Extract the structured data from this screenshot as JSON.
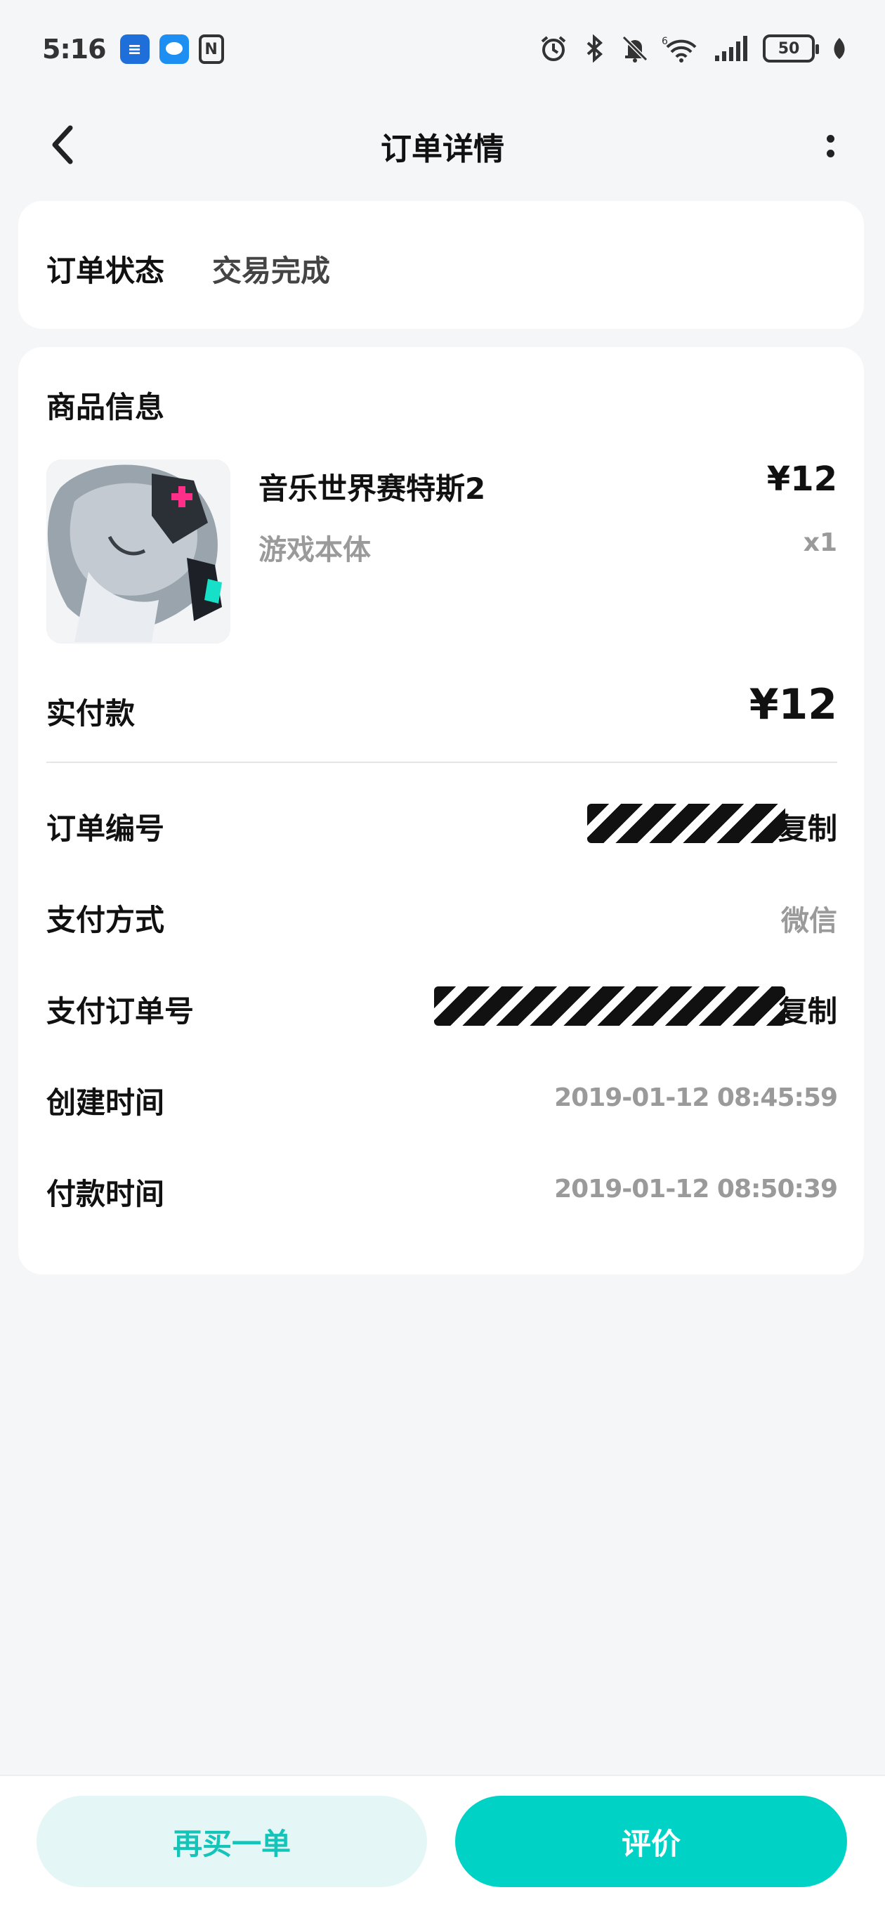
{
  "status_bar": {
    "time": "5:16",
    "notification_icons": [
      "list-app-icon",
      "chat-bubble-icon",
      "nfc-icon"
    ],
    "right_icons": [
      "alarm-icon",
      "bluetooth-icon",
      "mute-bell-icon",
      "wifi-6-icon",
      "signal-icon",
      "leaf-icon"
    ],
    "battery_level": "50"
  },
  "header": {
    "title": "订单详情",
    "back_icon": "chevron-left-icon",
    "more_icon": "more-vertical-icon"
  },
  "order_status": {
    "label": "订单状态",
    "value": "交易完成"
  },
  "product_section": {
    "title": "商品信息",
    "product": {
      "name": "音乐世界赛特斯2",
      "variant": "游戏本体",
      "price": "¥12",
      "quantity": "x1"
    },
    "paid_label": "实付款",
    "paid_value": "¥12"
  },
  "details": {
    "order_number": {
      "label": "订单编号",
      "copy": "复制"
    },
    "payment_method": {
      "label": "支付方式",
      "value": "微信"
    },
    "payment_order_number": {
      "label": "支付订单号",
      "copy": "复制"
    },
    "created_time": {
      "label": "创建时间",
      "value": "2019-01-12  08:45:59"
    },
    "paid_time": {
      "label": "付款时间",
      "value": "2019-01-12  08:50:39"
    }
  },
  "actions": {
    "rebuy": "再买一单",
    "review": "评价"
  },
  "colors": {
    "accent": "#00d3c5",
    "accent_light": "#e4f7f6",
    "background": "#f5f6f8"
  }
}
